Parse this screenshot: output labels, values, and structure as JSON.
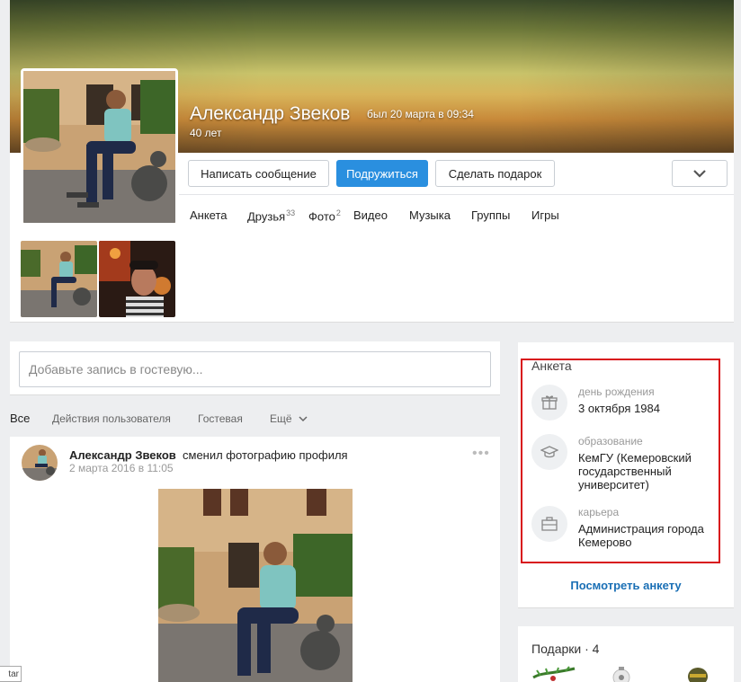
{
  "profile": {
    "name": "Александр Звеков",
    "last_seen": "был 20 марта в 09:34",
    "age": "40 лет"
  },
  "actions": {
    "message": "Написать сообщение",
    "friend": "Подружиться",
    "gift": "Сделать подарок"
  },
  "tabs": [
    {
      "label": "Анкета",
      "count": ""
    },
    {
      "label": "Друзья",
      "count": "33"
    },
    {
      "label": "Фото",
      "count": "2"
    },
    {
      "label": "Видео",
      "count": ""
    },
    {
      "label": "Музыка",
      "count": ""
    },
    {
      "label": "Группы",
      "count": ""
    },
    {
      "label": "Игры",
      "count": ""
    }
  ],
  "wall": {
    "placeholder": "Добавьте запись в гостевую..."
  },
  "filters": [
    "Все",
    "Действия пользователя",
    "Гостевая",
    "Ещё"
  ],
  "post": {
    "author": "Александр Звеков",
    "action": "сменил фотографию профиля",
    "date": "2 марта 2016 в 11:05",
    "menu": "•••"
  },
  "info": {
    "title": "Анкета",
    "items": [
      {
        "icon": "gift-icon",
        "label": "день рождения",
        "value": "3 октября 1984"
      },
      {
        "icon": "graduation-cap-icon",
        "label": "образование",
        "value": "КемГУ (Кемеровский государственный университет)"
      },
      {
        "icon": "briefcase-icon",
        "label": "карьера",
        "value": "Администрация города Кемерово"
      }
    ],
    "link": "Посмотреть анкету"
  },
  "gifts": {
    "title": "Подарки · 4"
  },
  "corner_tag": "tar",
  "colors": {
    "accent": "#2a8fdf",
    "link": "#1a6fb5",
    "highlight": "#d8121a",
    "background": "#edeef0"
  }
}
